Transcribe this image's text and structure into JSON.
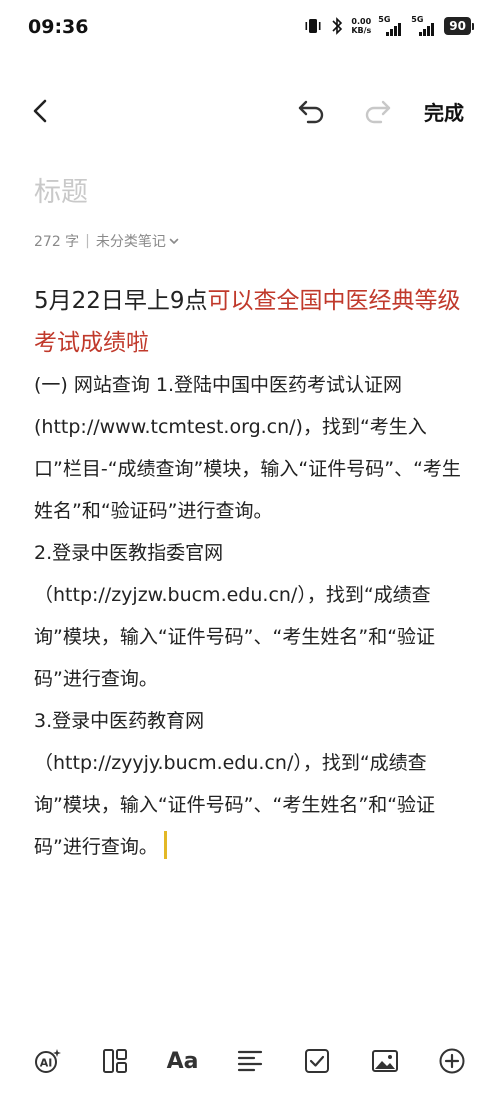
{
  "status_bar": {
    "time": "09:36",
    "net_speed_value": "0.00",
    "net_speed_unit": "KB/s",
    "signal1_label": "5G",
    "signal2_label": "5G",
    "battery": "90"
  },
  "toolbar": {
    "done_label": "完成"
  },
  "note": {
    "title_placeholder": "标题",
    "word_count": "272 字",
    "category": "未分类笔记",
    "headline_black": "5月22日早上9点",
    "headline_red": "可以查全国中医经典等级考试成绩啦",
    "paragraphs": [
      "(一) 网站查询 1.登陆中国中医药考试认证网(http://www.tcmtest.org.cn/)，找到“考生入口”栏目-“成绩查询”模块，输入“证件号码”、“考生姓名”和“验证码”进行查询。",
      "2.登录中医教指委官网（http://zyjzw.bucm.edu.cn/），找到“成绩查询”模块，输入“证件号码”、“考生姓名”和“验证码”进行查询。",
      "3.登录中医药教育网（http://zyyjy.bucm.edu.cn/），找到“成绩查询”模块，输入“证件号码”、“考生姓名”和“验证码”进行查询。"
    ]
  },
  "bottom_bar": {
    "font_label": "Aa"
  },
  "colors": {
    "accent_red": "#c0392b",
    "cursor": "#e3b826"
  }
}
